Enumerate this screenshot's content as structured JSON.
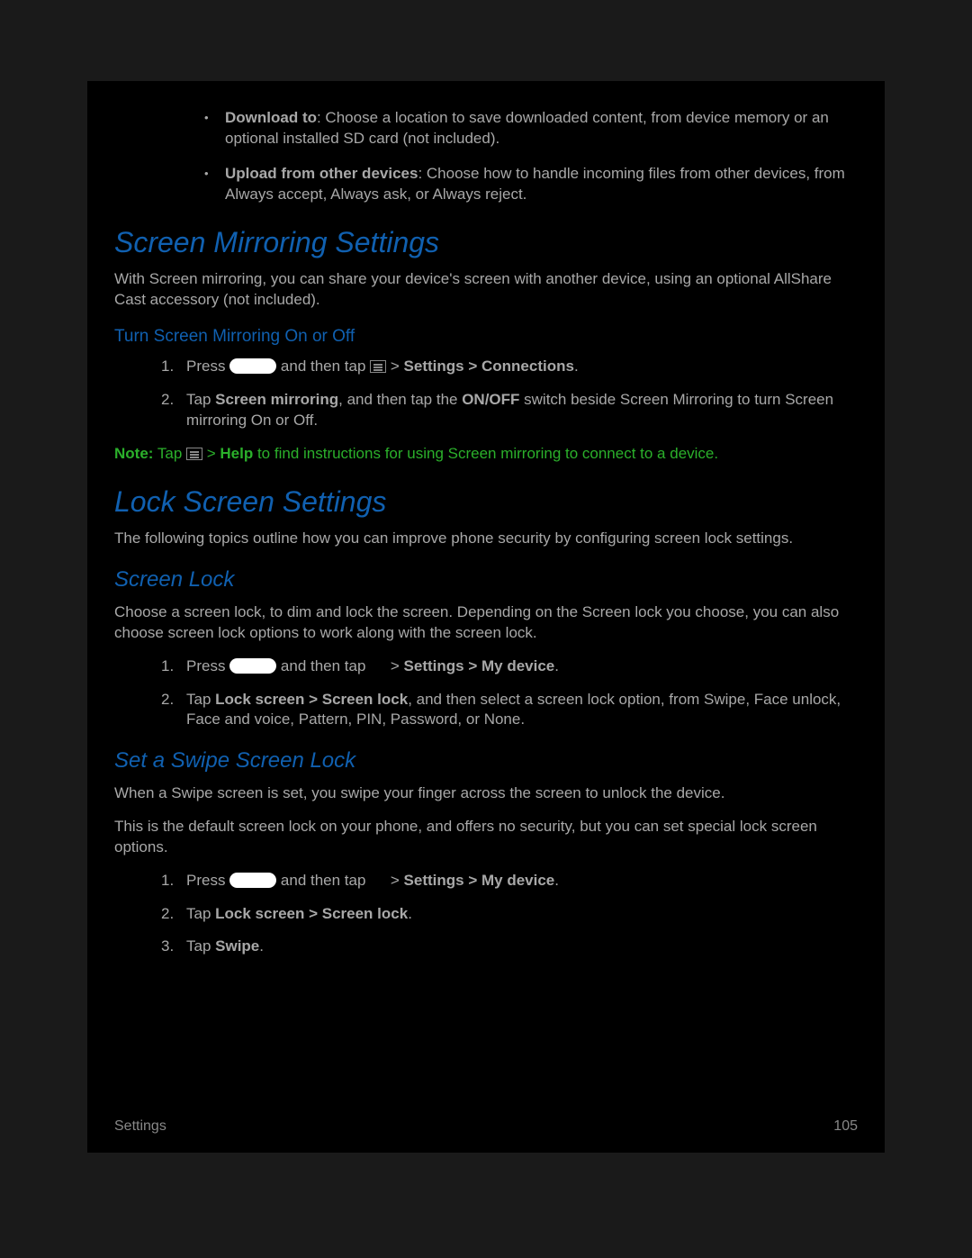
{
  "bullets": [
    {
      "title": "Download to",
      "text": ": Choose a location to save downloaded content, from device memory or an optional installed SD card (not included)."
    },
    {
      "title": "Upload from other devices",
      "text": ": Choose how to handle incoming files from other devices, from Always accept, Always ask, or Always reject."
    }
  ],
  "sm": {
    "heading": "Screen Mirroring Settings",
    "intro": "With Screen mirroring, you can share your device's screen with another device, using an optional AllShare Cast accessory (not included).",
    "sub": "Turn Screen Mirroring On or Off",
    "step1_a": "Press ",
    "step1_b": " and then tap ",
    "step1_c": " > ",
    "step1_d": "Settings > Connections",
    "step1_e": ".",
    "step2_a": "Tap ",
    "step2_b": "Screen mirroring",
    "step2_c": ", and then tap the ",
    "step2_d": "ON/OFF",
    "step2_e": " switch beside Screen Mirroring to turn Screen mirroring On or Off.",
    "note_label": "Note:",
    "note_a": " Tap ",
    "note_b": " > ",
    "note_help": "Help",
    "note_c": " to find instructions for using Screen mirroring to connect to a device."
  },
  "ls": {
    "heading": "Lock Screen Settings",
    "intro": "The following topics outline how you can improve phone security by configuring screen lock settings.",
    "sl_heading": "Screen Lock",
    "sl_intro": "Choose a screen lock, to dim and lock the screen. Depending on the Screen lock you choose, you can also choose screen lock options to work along with the screen lock.",
    "sl_step1_a": "Press ",
    "sl_step1_b": " and then tap ",
    "sl_step1_c": " > ",
    "sl_step1_d": "Settings > My device",
    "sl_step1_e": ".",
    "sl_step2_a": "Tap ",
    "sl_step2_b": "Lock screen > Screen lock",
    "sl_step2_c": ", and then select a screen lock option, from Swipe, Face unlock, Face and voice, Pattern, PIN, Password, or None.",
    "sw_heading": "Set a Swipe Screen Lock",
    "sw_p1": "When a Swipe screen is set, you swipe your finger across the screen to unlock the device.",
    "sw_p2": "This is the default screen lock on your phone, and offers no security, but you can set special lock screen options.",
    "sw_step1_a": "Press ",
    "sw_step1_b": " and then tap ",
    "sw_step1_c": " > ",
    "sw_step1_d": "Settings > My device",
    "sw_step1_e": ".",
    "sw_step2_a": "Tap ",
    "sw_step2_b": "Lock screen > Screen lock",
    "sw_step2_c": ".",
    "sw_step3_a": "Tap ",
    "sw_step3_b": "Swipe",
    "sw_step3_c": "."
  },
  "footer": {
    "section": "Settings",
    "page": "105"
  },
  "nums": {
    "n1": "1.",
    "n2": "2.",
    "n3": "3."
  }
}
